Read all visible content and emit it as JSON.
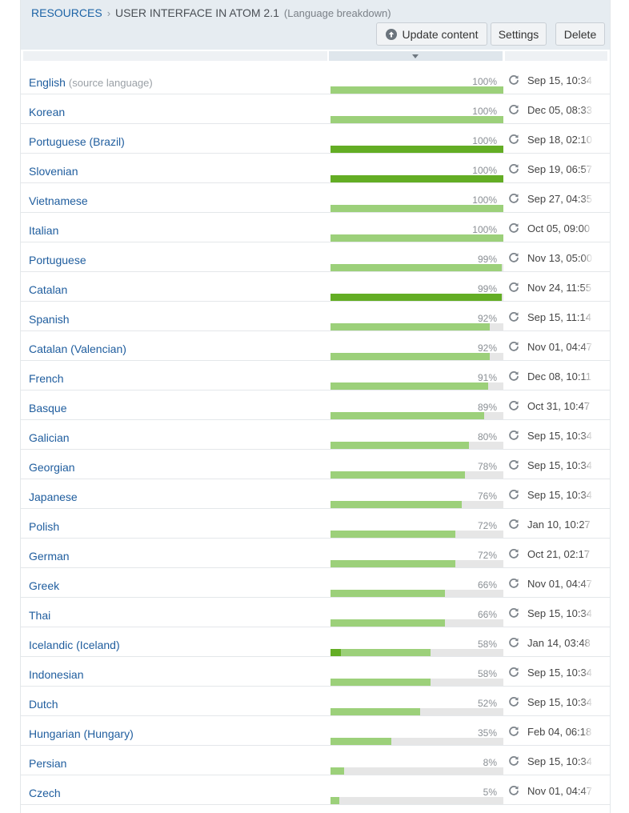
{
  "breadcrumb": {
    "root": "RESOURCES",
    "current": "USER INTERFACE IN ATOM 2.1",
    "note": "(Language breakdown)"
  },
  "actions": {
    "update": "Update content",
    "settings": "Settings",
    "delete": "Delete"
  },
  "colors": {
    "link": "#1f5d9e",
    "bar_light": "#9cd07a",
    "bar_dark": "#63ad24",
    "bar_track": "#e6e6e6",
    "header_bg": "#e6ecf1"
  },
  "languages": [
    {
      "name": "English",
      "note": "(source language)",
      "percent": "100%",
      "fill": 1.0,
      "dark": 0,
      "date": "Sep 15, 10:34"
    },
    {
      "name": "Korean",
      "note": "",
      "percent": "100%",
      "fill": 1.0,
      "dark": 0,
      "date": "Dec 05, 08:33"
    },
    {
      "name": "Portuguese (Brazil)",
      "note": "",
      "percent": "100%",
      "fill": 1.0,
      "dark": 1.0,
      "date": "Sep 18, 02:10"
    },
    {
      "name": "Slovenian",
      "note": "",
      "percent": "100%",
      "fill": 1.0,
      "dark": 1.0,
      "date": "Sep 19, 06:57"
    },
    {
      "name": "Vietnamese",
      "note": "",
      "percent": "100%",
      "fill": 1.0,
      "dark": 0,
      "date": "Sep 27, 04:35"
    },
    {
      "name": "Italian",
      "note": "",
      "percent": "100%",
      "fill": 1.0,
      "dark": 0,
      "date": "Oct 05, 09:00"
    },
    {
      "name": "Portuguese",
      "note": "",
      "percent": "99%",
      "fill": 0.99,
      "dark": 0,
      "date": "Nov 13, 05:00"
    },
    {
      "name": "Catalan",
      "note": "",
      "percent": "99%",
      "fill": 0.99,
      "dark": 0.99,
      "date": "Nov 24, 11:55"
    },
    {
      "name": "Spanish",
      "note": "",
      "percent": "92%",
      "fill": 0.92,
      "dark": 0,
      "date": "Sep 15, 11:14"
    },
    {
      "name": "Catalan (Valencian)",
      "note": "",
      "percent": "92%",
      "fill": 0.92,
      "dark": 0,
      "date": "Nov 01, 04:47"
    },
    {
      "name": "French",
      "note": "",
      "percent": "91%",
      "fill": 0.91,
      "dark": 0,
      "date": "Dec 08, 10:11"
    },
    {
      "name": "Basque",
      "note": "",
      "percent": "89%",
      "fill": 0.89,
      "dark": 0,
      "date": "Oct 31, 10:47"
    },
    {
      "name": "Galician",
      "note": "",
      "percent": "80%",
      "fill": 0.8,
      "dark": 0,
      "date": "Sep 15, 10:34"
    },
    {
      "name": "Georgian",
      "note": "",
      "percent": "78%",
      "fill": 0.78,
      "dark": 0,
      "date": "Sep 15, 10:34"
    },
    {
      "name": "Japanese",
      "note": "",
      "percent": "76%",
      "fill": 0.76,
      "dark": 0,
      "date": "Sep 15, 10:34"
    },
    {
      "name": "Polish",
      "note": "",
      "percent": "72%",
      "fill": 0.72,
      "dark": 0,
      "date": "Jan 10, 10:27"
    },
    {
      "name": "German",
      "note": "",
      "percent": "72%",
      "fill": 0.72,
      "dark": 0,
      "date": "Oct 21, 02:17"
    },
    {
      "name": "Greek",
      "note": "",
      "percent": "66%",
      "fill": 0.66,
      "dark": 0,
      "date": "Nov 01, 04:47"
    },
    {
      "name": "Thai",
      "note": "",
      "percent": "66%",
      "fill": 0.66,
      "dark": 0,
      "date": "Sep 15, 10:34"
    },
    {
      "name": "Icelandic (Iceland)",
      "note": "",
      "percent": "58%",
      "fill": 0.58,
      "dark": 0.06,
      "date": "Jan 14, 03:48"
    },
    {
      "name": "Indonesian",
      "note": "",
      "percent": "58%",
      "fill": 0.58,
      "dark": 0,
      "date": "Sep 15, 10:34"
    },
    {
      "name": "Dutch",
      "note": "",
      "percent": "52%",
      "fill": 0.52,
      "dark": 0,
      "date": "Sep 15, 10:34"
    },
    {
      "name": "Hungarian (Hungary)",
      "note": "",
      "percent": "35%",
      "fill": 0.35,
      "dark": 0,
      "date": "Feb 04, 06:18"
    },
    {
      "name": "Persian",
      "note": "",
      "percent": "8%",
      "fill": 0.08,
      "dark": 0,
      "date": "Sep 15, 10:34"
    },
    {
      "name": "Czech",
      "note": "",
      "percent": "5%",
      "fill": 0.05,
      "dark": 0,
      "date": "Nov 01, 04:47"
    }
  ]
}
